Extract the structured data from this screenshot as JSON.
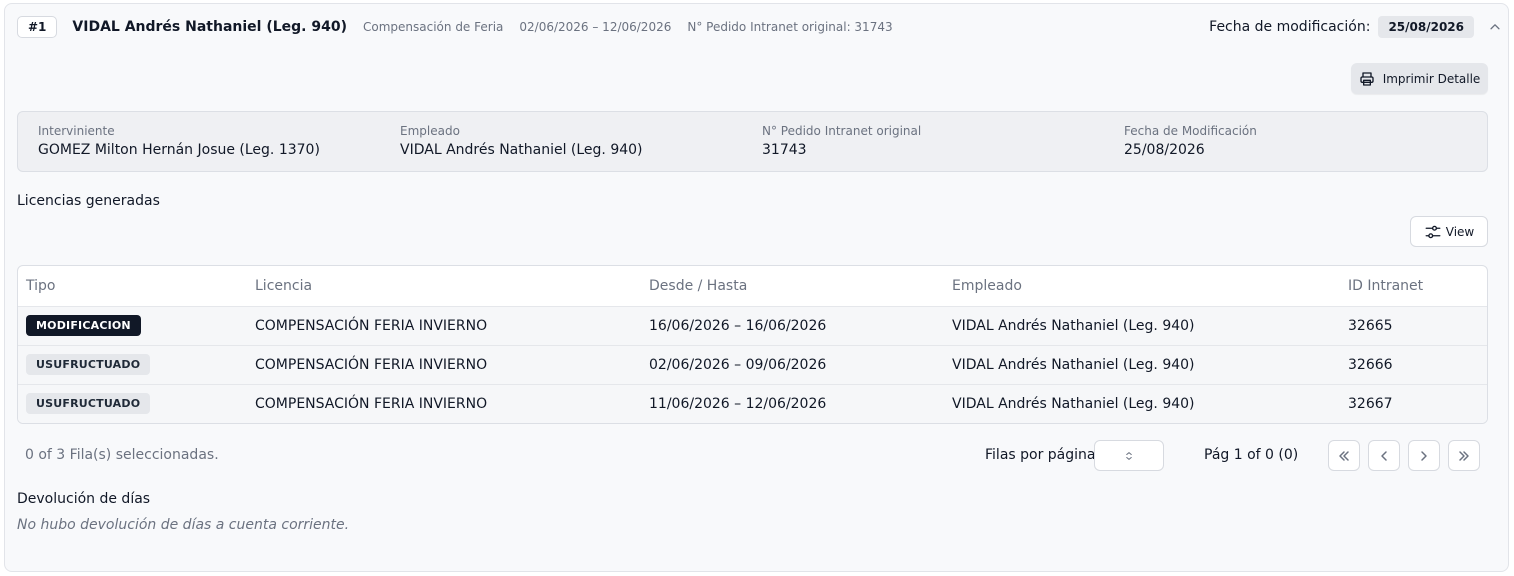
{
  "header": {
    "index": "#1",
    "employee_name": "VIDAL Andrés Nathaniel (Leg. 940)",
    "type": "Compensación de Feria",
    "period": "02/06/2026 – 12/06/2026",
    "intranet_ref": "N° Pedido Intranet original: 31743",
    "mod_date_label": "Fecha de modificación:",
    "mod_date": "25/08/2026",
    "collapse_icon": "chevron-up-icon"
  },
  "actions": {
    "print_label": "Imprimir Detalle",
    "print_icon": "printer-icon",
    "view_label": "View",
    "view_icon": "sliders-icon"
  },
  "info": {
    "interviniente_label": "Interviniente",
    "interviniente_value": "GOMEZ Milton Hernán Josue (Leg. 1370)",
    "empleado_label": "Empleado",
    "empleado_value": "VIDAL Andrés Nathaniel (Leg. 940)",
    "pedido_label": "N° Pedido Intranet original",
    "pedido_value": "31743",
    "fecha_label": "Fecha de Modificación",
    "fecha_value": "25/08/2026"
  },
  "licencias": {
    "title": "Licencias generadas",
    "columns": [
      "Tipo",
      "Licencia",
      "Desde / Hasta",
      "Empleado",
      "ID Intranet"
    ],
    "rows": [
      {
        "tipo": "MODIFICACION",
        "tipo_style": "dark",
        "licencia": "COMPENSACIÓN FERIA INVIERNO",
        "rango": "16/06/2026 – 16/06/2026",
        "empleado": "VIDAL Andrés Nathaniel (Leg. 940)",
        "id": "32665"
      },
      {
        "tipo": "USUFRUCTUADO",
        "tipo_style": "light",
        "licencia": "COMPENSACIÓN FERIA INVIERNO",
        "rango": "02/06/2026 – 09/06/2026",
        "empleado": "VIDAL Andrés Nathaniel (Leg. 940)",
        "id": "32666"
      },
      {
        "tipo": "USUFRUCTUADO",
        "tipo_style": "light",
        "licencia": "COMPENSACIÓN FERIA INVIERNO",
        "rango": "11/06/2026 – 12/06/2026",
        "empleado": "VIDAL Andrés Nathaniel (Leg. 940)",
        "id": "32667"
      }
    ]
  },
  "pagination": {
    "selected_text": "0 of 3 Fila(s) seleccionadas.",
    "rows_per_page_label": "Filas por página",
    "rows_per_page_value": "",
    "page_info": "Pág 1 of 0 (0)"
  },
  "devolucion": {
    "title": "Devolución de días",
    "empty_text": "No hubo devolución de días a cuenta corriente."
  },
  "colors": {
    "card_bg": "#f8f9fb",
    "badge_dark": "#111827",
    "badge_light": "#e5e7eb",
    "muted_text": "#6b7280"
  }
}
